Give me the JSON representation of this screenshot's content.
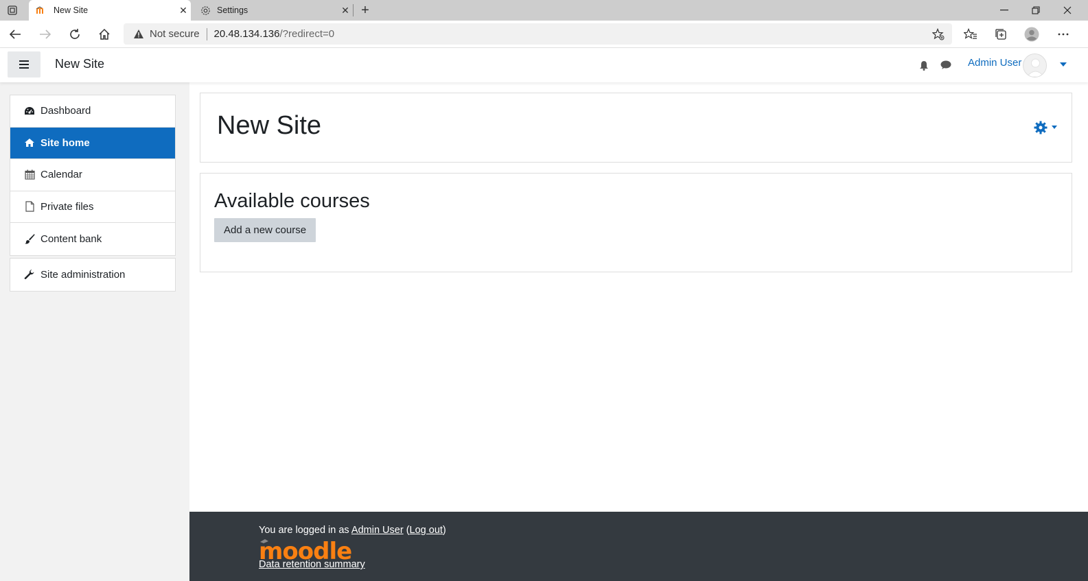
{
  "browser": {
    "tabs": [
      {
        "title": "New Site",
        "close": "✕"
      },
      {
        "title": "Settings",
        "close": "✕"
      }
    ],
    "new_tab": "+",
    "window_controls": {
      "minimize": "—",
      "restore": "❐",
      "close": "✕"
    },
    "address": {
      "security_label": "Not secure",
      "host": "20.48.134.136",
      "path": "/?redirect=0"
    }
  },
  "header": {
    "site_name": "New Site",
    "user_name": "Admin User"
  },
  "nav": {
    "items": [
      {
        "label": "Dashboard",
        "icon": "dashboard-icon"
      },
      {
        "label": "Site home",
        "icon": "home-icon",
        "active": true
      },
      {
        "label": "Calendar",
        "icon": "calendar-icon"
      },
      {
        "label": "Private files",
        "icon": "file-icon"
      },
      {
        "label": "Content bank",
        "icon": "paintbrush-icon"
      }
    ],
    "admin": {
      "label": "Site administration",
      "icon": "wrench-icon"
    }
  },
  "main": {
    "page_title": "New Site",
    "courses_heading": "Available courses",
    "add_course_label": "Add a new course"
  },
  "footer": {
    "logged_in_prefix": "You are logged in as ",
    "user_link": "Admin User",
    "logout_open": " (",
    "logout_link": "Log out",
    "logout_close": ")",
    "logo_text": "moodle",
    "data_retention": "Data retention summary"
  },
  "colors": {
    "brand": "#0f6cbf",
    "footer_bg": "#343a40",
    "moodle_orange": "#f98012"
  }
}
